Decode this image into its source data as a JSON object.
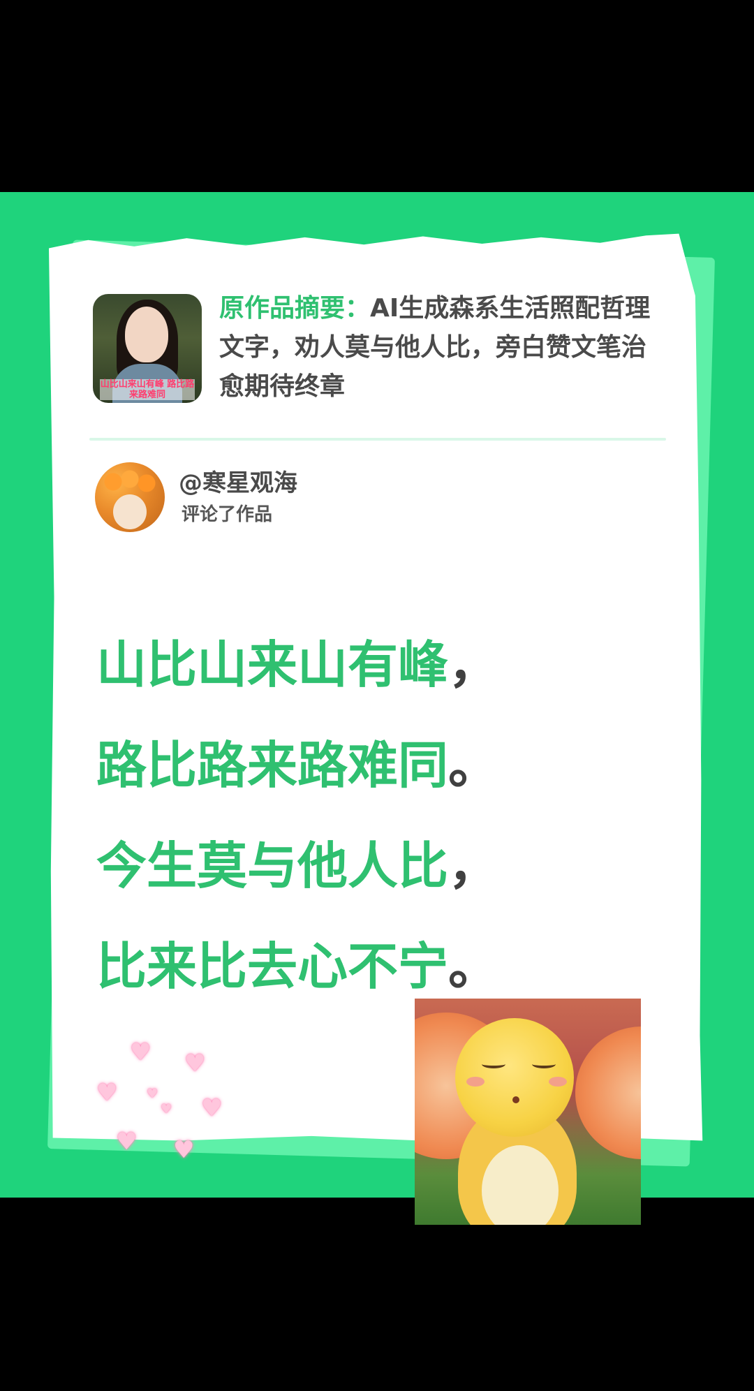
{
  "summary": {
    "label": "原作品摘要：",
    "text": "AI生成森系生活照配哲理文字，劝人莫与他人比，旁白赞文笔治愈期待终章",
    "thumbnail_caption": "山比山来山有峰 路比路来路难同"
  },
  "comment": {
    "username": "@寒星观海",
    "action": "评论了作品"
  },
  "poem": {
    "lines": [
      {
        "text": "山比山来山有峰",
        "punct": "，"
      },
      {
        "text": "路比路来路难同",
        "punct": "。"
      },
      {
        "text": "今生莫与他人比",
        "punct": "，"
      },
      {
        "text": "比来比去心不宁",
        "punct": "。"
      }
    ]
  },
  "colors": {
    "background": "#1fd37c",
    "accent_green": "#2fc070",
    "text_dark": "#4a4a4a"
  },
  "decorations": {
    "hearts_icon": "heart-icon",
    "sticker": "cartoon-sticker"
  }
}
